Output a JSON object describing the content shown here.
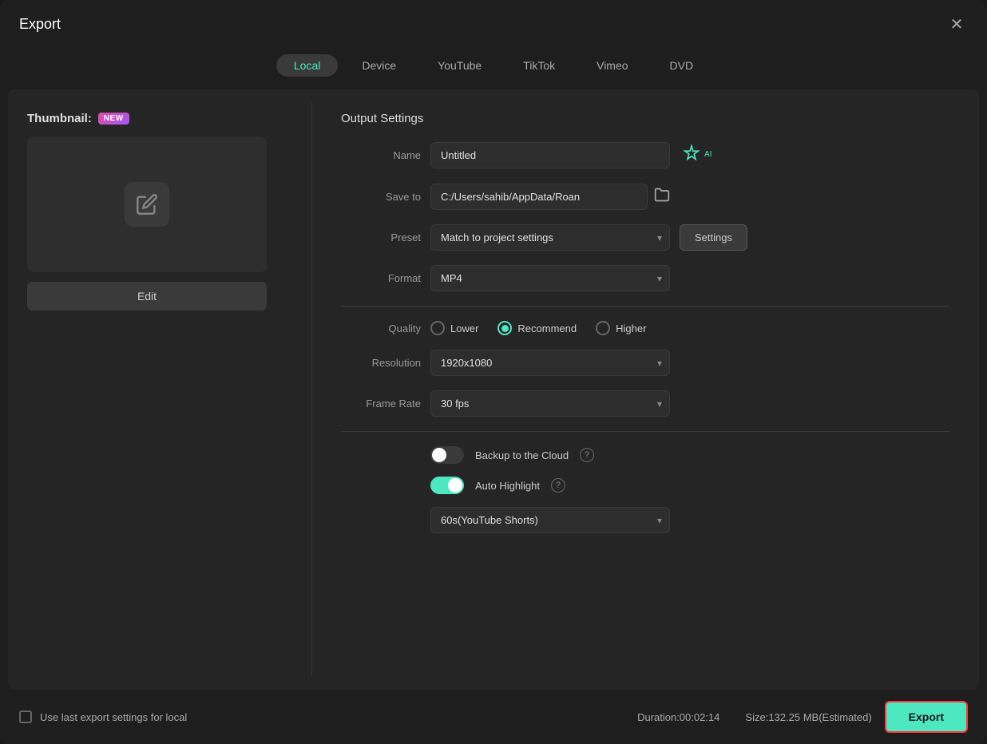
{
  "modal": {
    "title": "Export",
    "close_label": "✕"
  },
  "tabs": [
    {
      "label": "Local",
      "active": true
    },
    {
      "label": "Device",
      "active": false
    },
    {
      "label": "YouTube",
      "active": false
    },
    {
      "label": "TikTok",
      "active": false
    },
    {
      "label": "Vimeo",
      "active": false
    },
    {
      "label": "DVD",
      "active": false
    }
  ],
  "thumbnail": {
    "label": "Thumbnail:",
    "badge": "NEW",
    "edit_btn": "Edit"
  },
  "output_settings": {
    "section_title": "Output Settings",
    "name_label": "Name",
    "name_value": "Untitled",
    "save_to_label": "Save to",
    "save_to_value": "C:/Users/sahib/AppData/Roan",
    "preset_label": "Preset",
    "preset_value": "Match to project settings",
    "settings_btn": "Settings",
    "format_label": "Format",
    "format_value": "MP4",
    "quality_label": "Quality",
    "quality_options": [
      {
        "label": "Lower",
        "selected": false
      },
      {
        "label": "Recommend",
        "selected": true
      },
      {
        "label": "Higher",
        "selected": false
      }
    ],
    "resolution_label": "Resolution",
    "resolution_value": "1920x1080",
    "framerate_label": "Frame Rate",
    "framerate_value": "30 fps",
    "backup_label": "Backup to the Cloud",
    "backup_on": false,
    "auto_highlight_label": "Auto Highlight",
    "auto_highlight_on": true,
    "highlight_duration": "60s(YouTube Shorts)"
  },
  "bottom_bar": {
    "checkbox_label": "Use last export settings for local",
    "duration_label": "Duration:00:02:14",
    "size_label": "Size:132.25 MB(Estimated)",
    "export_btn": "Export"
  }
}
